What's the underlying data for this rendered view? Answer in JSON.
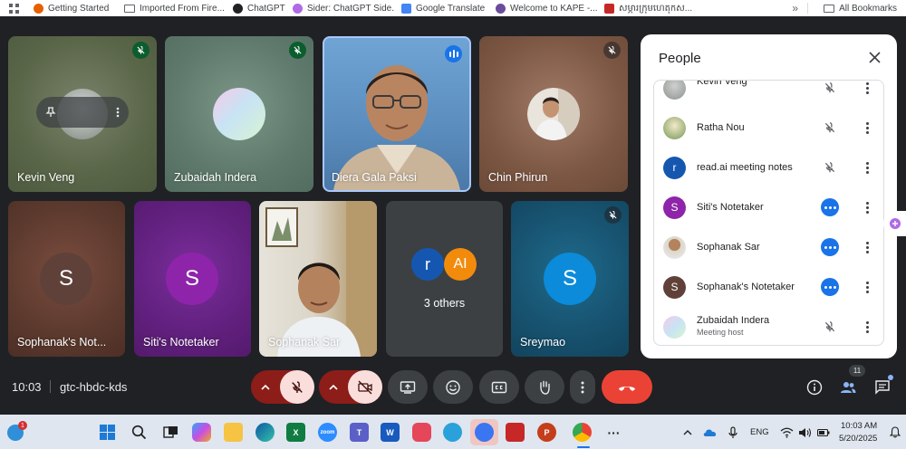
{
  "bookmarks": {
    "items": [
      {
        "label": "Getting Started",
        "icon": "firefox-icon",
        "color": "#e66000"
      },
      {
        "label": "Imported From Fire...",
        "icon": "folder-icon"
      },
      {
        "label": "ChatGPT",
        "icon": "chatgpt-icon",
        "color": "#202124"
      },
      {
        "label": "Sider: ChatGPT Side...",
        "icon": "sider-icon",
        "color": "#b06ae6"
      },
      {
        "label": "Google Translate",
        "icon": "google-translate-icon",
        "color": "#4285f4"
      },
      {
        "label": "Welcome to KAPE -...",
        "icon": "kape-icon",
        "color": "#6a4c9c"
      },
      {
        "label": "សម្ភារក្រុមហេតុកស...",
        "icon": "bookmark-site-icon",
        "color": "#c62828"
      }
    ],
    "more": "»",
    "all_bookmarks": "All Bookmarks"
  },
  "tiles": [
    {
      "name": "Kevin Veng",
      "muted": true
    },
    {
      "name": "Zubaidah Indera",
      "muted": true
    },
    {
      "name": "Diera Gala Paksi",
      "speaking": true
    },
    {
      "name": "Chin Phirun",
      "muted": true
    },
    {
      "name": "Sophanak's Not...",
      "avatar_letter": "S"
    },
    {
      "name": "Siti's Notetaker",
      "avatar_letter": "S"
    },
    {
      "name": "Sophanak Sar"
    },
    {
      "name": "3 others",
      "avatars": [
        "r",
        "AI"
      ]
    },
    {
      "name": "Sreymao",
      "avatar_letter": "S",
      "muted": true
    }
  ],
  "people": {
    "title": "People",
    "list": [
      {
        "name": "Kevin Veng",
        "status": "muted"
      },
      {
        "name": "Ratha Nou",
        "status": "muted"
      },
      {
        "name": "read.ai meeting notes",
        "status": "muted",
        "letter": "r"
      },
      {
        "name": "Siti's Notetaker",
        "status": "more",
        "letter": "S"
      },
      {
        "name": "Sophanak Sar",
        "status": "more"
      },
      {
        "name": "Sophanak's Notetaker",
        "status": "more",
        "letter": "S"
      },
      {
        "name": "Zubaidah Indera",
        "sub": "Meeting host",
        "status": "muted"
      }
    ]
  },
  "meeting": {
    "time": "10:03",
    "code": "gtc-hbdc-kds",
    "participant_count": "11"
  },
  "taskbar": {
    "notification_count": "1",
    "language": "ENG",
    "time": "10:03 AM",
    "date": "5/20/2025"
  },
  "colors": {
    "accent": "#1a73e8",
    "end_call": "#ea4335",
    "muted_control": "#8c1d18"
  }
}
